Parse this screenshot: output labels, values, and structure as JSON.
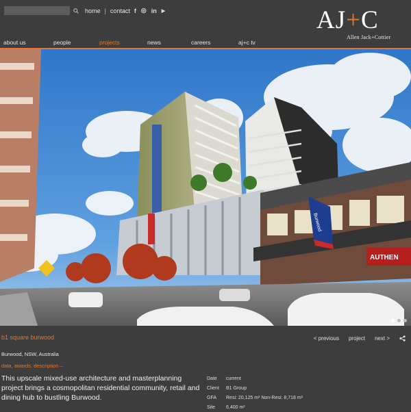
{
  "header": {
    "search": {
      "placeholder": ""
    },
    "links": {
      "home": "home",
      "separator": "|",
      "contact": "contact"
    },
    "social": [
      "facebook-icon",
      "instagram-icon",
      "linkedin-icon",
      "youtube-icon"
    ],
    "social_glyphs": {
      "facebook": "f",
      "instagram": "◎",
      "linkedin": "in",
      "youtube": "▶"
    },
    "logo": {
      "left": "AJ",
      "plus": "+",
      "right": "C",
      "sub": "Allen Jack+Cottier"
    }
  },
  "nav": {
    "items": [
      "about us",
      "people",
      "projects",
      "news",
      "careers",
      "aj+c tv"
    ],
    "active": "projects",
    "accent": "#e8762b"
  },
  "hero": {
    "slides": 3,
    "active_slide": 0,
    "sign_text": "Burwood",
    "shop_text": "AUTHEN"
  },
  "project": {
    "title": "b1 square burwood",
    "nav": {
      "previous": "< previous",
      "projects": "project",
      "next": "next >"
    },
    "location": "Burwood, NSW, Australia",
    "links": "data, awards, description –",
    "description": "This upscale mixed-use architecture and masterplanning project brings a cosmopolitan residential community, retail and dining hub to bustling Burwood.",
    "meta": [
      {
        "key": "Date",
        "value": "current"
      },
      {
        "key": "Client",
        "value": "B1 Group"
      },
      {
        "key": "GFA",
        "value": "Resi: 20,125 m² Non-Resi: 8,718 m²"
      },
      {
        "key": "Site",
        "value": "6,400 m²"
      }
    ]
  }
}
